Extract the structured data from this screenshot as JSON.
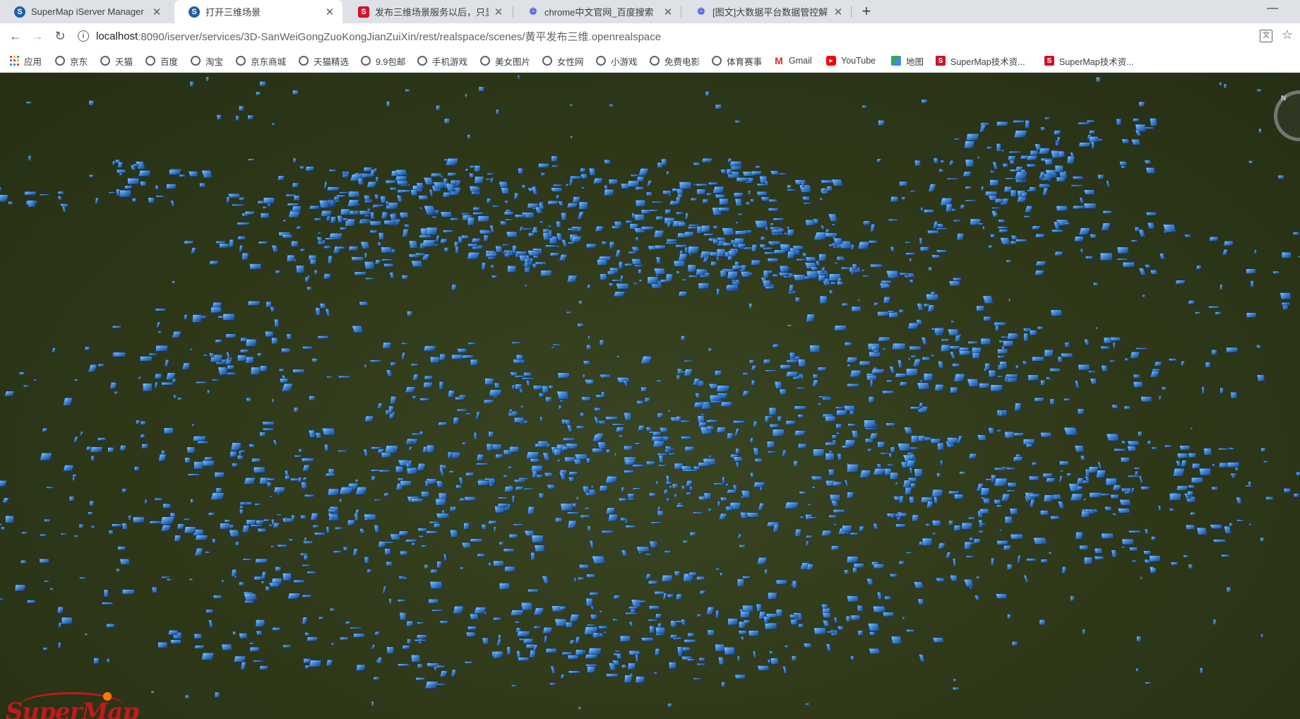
{
  "tabs": [
    {
      "title": "SuperMap iServer Manager",
      "icon": "supermap-icon",
      "active": false
    },
    {
      "title": "打开三维场景",
      "icon": "supermap-icon",
      "active": true
    },
    {
      "title": "发布三维场景服务以后，只显示",
      "icon": "supermap-s-icon",
      "active": false
    },
    {
      "title": "chrome中文官网_百度搜索",
      "icon": "baidu-icon",
      "active": false
    },
    {
      "title": "[图文]大数据平台数据管控解决方",
      "icon": "baidu-icon",
      "active": false
    }
  ],
  "toolbar": {
    "url_host": "localhost",
    "url_path": ":8090/iserver/services/3D-SanWeiGongZuoKongJianZuiXin/rest/realspace/scenes/黄平发布三维.openrealspace"
  },
  "bookmarks": [
    {
      "label": "应用",
      "icon": "apps-icon"
    },
    {
      "label": "京东",
      "icon": "globe-icon"
    },
    {
      "label": "天猫",
      "icon": "globe-icon"
    },
    {
      "label": "百度",
      "icon": "globe-icon"
    },
    {
      "label": "淘宝",
      "icon": "globe-icon"
    },
    {
      "label": "京东商城",
      "icon": "globe-icon"
    },
    {
      "label": "天猫精选",
      "icon": "globe-icon"
    },
    {
      "label": "9.9包邮",
      "icon": "globe-icon"
    },
    {
      "label": "手机游戏",
      "icon": "globe-icon"
    },
    {
      "label": "美女图片",
      "icon": "globe-icon"
    },
    {
      "label": "女性网",
      "icon": "globe-icon"
    },
    {
      "label": "小游戏",
      "icon": "globe-icon"
    },
    {
      "label": "免费电影",
      "icon": "globe-icon"
    },
    {
      "label": "体育赛事",
      "icon": "globe-icon"
    },
    {
      "label": "Gmail",
      "icon": "gmail-icon"
    },
    {
      "label": "YouTube",
      "icon": "youtube-icon"
    },
    {
      "label": "地图",
      "icon": "maps-icon"
    },
    {
      "label": "SuperMap技术资...",
      "icon": "supermap-s-icon"
    },
    {
      "label": "SuperMap技术资...",
      "icon": "supermap-s-icon"
    }
  ],
  "scene": {
    "compass_label": "N",
    "logo_text": "SuperMap",
    "colors": {
      "ground": "#2e3819",
      "building_dark": "#1a4a8a",
      "building_light": "#5aa8f0",
      "building_edge": "#8fd0ff"
    }
  }
}
